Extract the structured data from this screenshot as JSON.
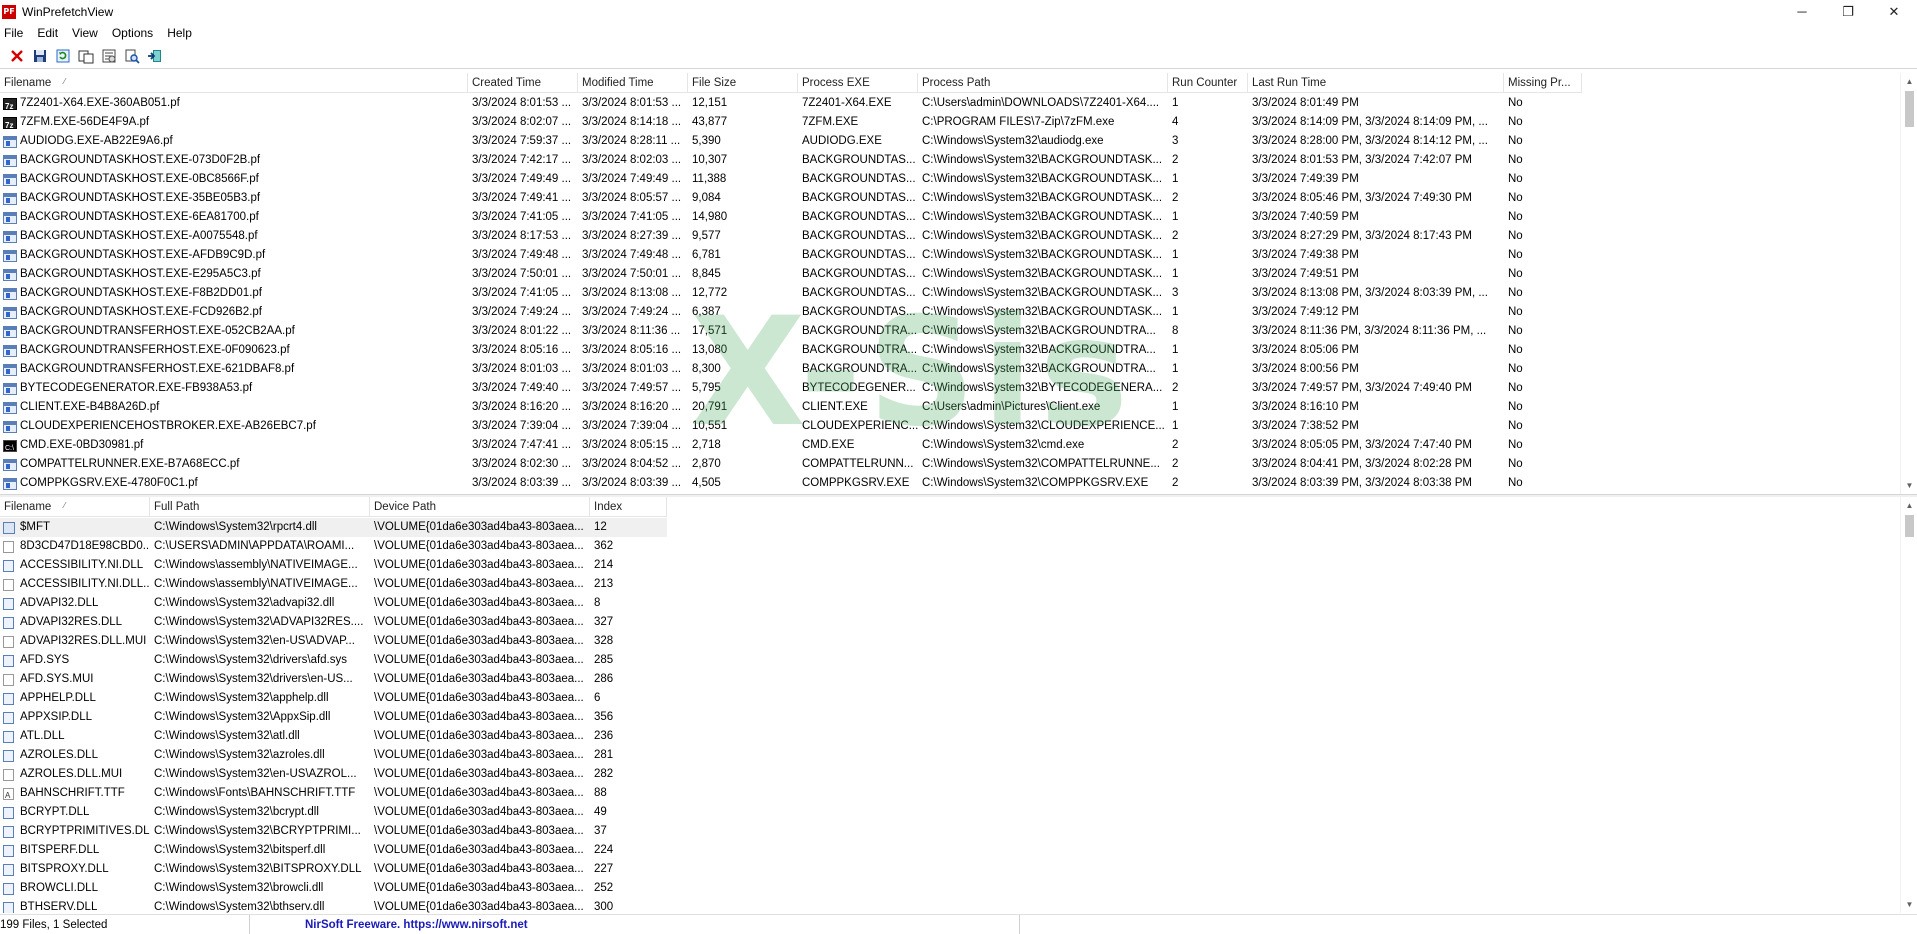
{
  "window": {
    "title": "WinPrefetchView",
    "icon_label": "PF",
    "minimize": "─",
    "restore": "❐",
    "close": "✕"
  },
  "menu": [
    "File",
    "Edit",
    "View",
    "Options",
    "Help"
  ],
  "toolbar": [
    "delete-icon",
    "save-icon",
    "refresh-icon",
    "copy-icon",
    "properties-icon",
    "find-icon",
    "exit-icon"
  ],
  "top_table": {
    "columns": [
      "Filename",
      "Created Time",
      "Modified Time",
      "File Size",
      "Process EXE",
      "Process Path",
      "Run Counter",
      "Last Run Time",
      "Missing Pr..."
    ],
    "sort_indicator": "⁄",
    "rows": [
      [
        "zip",
        "7Z2401-X64.EXE-360AB051.pf",
        "3/3/2024 8:01:53 ...",
        "3/3/2024 8:01:53 ...",
        "12,151",
        "7Z2401-X64.EXE",
        "C:\\Users\\admin\\DOWNLOADS\\7Z2401-X64....",
        "1",
        "3/3/2024 8:01:49 PM",
        "No"
      ],
      [
        "zip",
        "7ZFM.EXE-56DE4F9A.pf",
        "3/3/2024 8:02:07 ...",
        "3/3/2024 8:14:18 ...",
        "43,877",
        "7ZFM.EXE",
        "C:\\PROGRAM FILES\\7-Zip\\7zFM.exe",
        "4",
        "3/3/2024 8:14:09 PM, 3/3/2024 8:14:09 PM, ...",
        "No"
      ],
      [
        "app",
        "AUDIODG.EXE-AB22E9A6.pf",
        "3/3/2024 7:59:37 ...",
        "3/3/2024 8:28:11 ...",
        "5,390",
        "AUDIODG.EXE",
        "C:\\Windows\\System32\\audiodg.exe",
        "3",
        "3/3/2024 8:28:00 PM, 3/3/2024 8:14:12 PM, ...",
        "No"
      ],
      [
        "app",
        "BACKGROUNDTASKHOST.EXE-073D0F2B.pf",
        "3/3/2024 7:42:17 ...",
        "3/3/2024 8:02:03 ...",
        "10,307",
        "BACKGROUNDTAS...",
        "C:\\Windows\\System32\\BACKGROUNDTASK...",
        "2",
        "3/3/2024 8:01:53 PM, 3/3/2024 7:42:07 PM",
        "No"
      ],
      [
        "app",
        "BACKGROUNDTASKHOST.EXE-0BC8566F.pf",
        "3/3/2024 7:49:49 ...",
        "3/3/2024 7:49:49 ...",
        "11,388",
        "BACKGROUNDTAS...",
        "C:\\Windows\\System32\\BACKGROUNDTASK...",
        "1",
        "3/3/2024 7:49:39 PM",
        "No"
      ],
      [
        "app",
        "BACKGROUNDTASKHOST.EXE-35BE05B3.pf",
        "3/3/2024 7:49:41 ...",
        "3/3/2024 8:05:57 ...",
        "9,084",
        "BACKGROUNDTAS...",
        "C:\\Windows\\System32\\BACKGROUNDTASK...",
        "2",
        "3/3/2024 8:05:46 PM, 3/3/2024 7:49:30 PM",
        "No"
      ],
      [
        "app",
        "BACKGROUNDTASKHOST.EXE-6EA81700.pf",
        "3/3/2024 7:41:05 ...",
        "3/3/2024 7:41:05 ...",
        "14,980",
        "BACKGROUNDTAS...",
        "C:\\Windows\\System32\\BACKGROUNDTASK...",
        "1",
        "3/3/2024 7:40:59 PM",
        "No"
      ],
      [
        "app",
        "BACKGROUNDTASKHOST.EXE-A0075548.pf",
        "3/3/2024 8:17:53 ...",
        "3/3/2024 8:27:39 ...",
        "9,577",
        "BACKGROUNDTAS...",
        "C:\\Windows\\System32\\BACKGROUNDTASK...",
        "2",
        "3/3/2024 8:27:29 PM, 3/3/2024 8:17:43 PM",
        "No"
      ],
      [
        "app",
        "BACKGROUNDTASKHOST.EXE-AFDB9C9D.pf",
        "3/3/2024 7:49:48 ...",
        "3/3/2024 7:49:48 ...",
        "6,781",
        "BACKGROUNDTAS...",
        "C:\\Windows\\System32\\BACKGROUNDTASK...",
        "1",
        "3/3/2024 7:49:38 PM",
        "No"
      ],
      [
        "app",
        "BACKGROUNDTASKHOST.EXE-E295A5C3.pf",
        "3/3/2024 7:50:01 ...",
        "3/3/2024 7:50:01 ...",
        "8,845",
        "BACKGROUNDTAS...",
        "C:\\Windows\\System32\\BACKGROUNDTASK...",
        "1",
        "3/3/2024 7:49:51 PM",
        "No"
      ],
      [
        "app",
        "BACKGROUNDTASKHOST.EXE-F8B2DD01.pf",
        "3/3/2024 7:41:05 ...",
        "3/3/2024 8:13:08 ...",
        "12,772",
        "BACKGROUNDTAS...",
        "C:\\Windows\\System32\\BACKGROUNDTASK...",
        "3",
        "3/3/2024 8:13:08 PM, 3/3/2024 8:03:39 PM, ...",
        "No"
      ],
      [
        "app",
        "BACKGROUNDTASKHOST.EXE-FCD926B2.pf",
        "3/3/2024 7:49:24 ...",
        "3/3/2024 7:49:24 ...",
        "6,387",
        "BACKGROUNDTAS...",
        "C:\\Windows\\System32\\BACKGROUNDTASK...",
        "1",
        "3/3/2024 7:49:12 PM",
        "No"
      ],
      [
        "app",
        "BACKGROUNDTRANSFERHOST.EXE-052CB2AA.pf",
        "3/3/2024 8:01:22 ...",
        "3/3/2024 8:11:36 ...",
        "17,571",
        "BACKGROUNDTRA...",
        "C:\\Windows\\System32\\BACKGROUNDTRA...",
        "8",
        "3/3/2024 8:11:36 PM, 3/3/2024 8:11:36 PM, ...",
        "No"
      ],
      [
        "app",
        "BACKGROUNDTRANSFERHOST.EXE-0F090623.pf",
        "3/3/2024 8:05:16 ...",
        "3/3/2024 8:05:16 ...",
        "13,080",
        "BACKGROUNDTRA...",
        "C:\\Windows\\System32\\BACKGROUNDTRA...",
        "1",
        "3/3/2024 8:05:06 PM",
        "No"
      ],
      [
        "app",
        "BACKGROUNDTRANSFERHOST.EXE-621DBAF8.pf",
        "3/3/2024 8:01:03 ...",
        "3/3/2024 8:01:03 ...",
        "8,300",
        "BACKGROUNDTRA...",
        "C:\\Windows\\System32\\BACKGROUNDTRA...",
        "1",
        "3/3/2024 8:00:56 PM",
        "No"
      ],
      [
        "app",
        "BYTECODEGENERATOR.EXE-FB938A53.pf",
        "3/3/2024 7:49:40 ...",
        "3/3/2024 7:49:57 ...",
        "5,795",
        "BYTECODEGENER...",
        "C:\\Windows\\System32\\BYTECODEGENERA...",
        "2",
        "3/3/2024 7:49:57 PM, 3/3/2024 7:49:40 PM",
        "No"
      ],
      [
        "app",
        "CLIENT.EXE-B4B8A26D.pf",
        "3/3/2024 8:16:20 ...",
        "3/3/2024 8:16:20 ...",
        "20,791",
        "CLIENT.EXE",
        "C:\\Users\\admin\\Pictures\\Client.exe",
        "1",
        "3/3/2024 8:16:10 PM",
        "No"
      ],
      [
        "app",
        "CLOUDEXPERIENCEHOSTBROKER.EXE-AB26EBC7.pf",
        "3/3/2024 7:39:04 ...",
        "3/3/2024 7:39:04 ...",
        "10,551",
        "CLOUDEXPERIENC...",
        "C:\\Windows\\System32\\CLOUDEXPERIENCE...",
        "1",
        "3/3/2024 7:38:52 PM",
        "No"
      ],
      [
        "cmd",
        "CMD.EXE-0BD30981.pf",
        "3/3/2024 7:47:41 ...",
        "3/3/2024 8:05:15 ...",
        "2,718",
        "CMD.EXE",
        "C:\\Windows\\System32\\cmd.exe",
        "2",
        "3/3/2024 8:05:05 PM, 3/3/2024 7:47:40 PM",
        "No"
      ],
      [
        "app",
        "COMPATTELRUNNER.EXE-B7A68ECC.pf",
        "3/3/2024 8:02:30 ...",
        "3/3/2024 8:04:52 ...",
        "2,870",
        "COMPATTELRUNN...",
        "C:\\Windows\\System32\\COMPATTELRUNNE...",
        "2",
        "3/3/2024 8:04:41 PM, 3/3/2024 8:02:28 PM",
        "No"
      ],
      [
        "app",
        "COMPPKGSRV.EXE-4780F0C1.pf",
        "3/3/2024 8:03:39 ...",
        "3/3/2024 8:03:39 ...",
        "4,505",
        "COMPPKGSRV.EXE",
        "C:\\Windows\\System32\\COMPPKGSRV.EXE",
        "2",
        "3/3/2024 8:03:39 PM, 3/3/2024 8:03:38 PM",
        "No"
      ]
    ]
  },
  "bottom_table": {
    "columns": [
      "Filename",
      "Full Path",
      "Device Path",
      "Index"
    ],
    "sort_indicator": "⁄",
    "rows": [
      [
        "mft",
        "$MFT",
        "C:\\Windows\\System32\\rpcrt4.dll",
        "\\VOLUME{01da6e303ad4ba43-803aea...",
        "12"
      ],
      [
        "doc",
        "8D3CD47D18E98CBD0...",
        "C:\\USERS\\ADMIN\\APPDATA\\ROAMI...",
        "\\VOLUME{01da6e303ad4ba43-803aea...",
        "362"
      ],
      [
        "docsys",
        "ACCESSIBILITY.NI.DLL",
        "C:\\Windows\\assembly\\NATIVEIMAGE...",
        "\\VOLUME{01da6e303ad4ba43-803aea...",
        "214"
      ],
      [
        "doc",
        "ACCESSIBILITY.NI.DLL...",
        "C:\\Windows\\assembly\\NATIVEIMAGE...",
        "\\VOLUME{01da6e303ad4ba43-803aea...",
        "213"
      ],
      [
        "docsys",
        "ADVAPI32.DLL",
        "C:\\Windows\\System32\\advapi32.dll",
        "\\VOLUME{01da6e303ad4ba43-803aea...",
        "8"
      ],
      [
        "docsys",
        "ADVAPI32RES.DLL",
        "C:\\Windows\\System32\\ADVAPI32RES....",
        "\\VOLUME{01da6e303ad4ba43-803aea...",
        "327"
      ],
      [
        "doc",
        "ADVAPI32RES.DLL.MUI",
        "C:\\Windows\\System32\\en-US\\ADVAP...",
        "\\VOLUME{01da6e303ad4ba43-803aea...",
        "328"
      ],
      [
        "docsys",
        "AFD.SYS",
        "C:\\Windows\\System32\\drivers\\afd.sys",
        "\\VOLUME{01da6e303ad4ba43-803aea...",
        "285"
      ],
      [
        "doc",
        "AFD.SYS.MUI",
        "C:\\Windows\\System32\\drivers\\en-US...",
        "\\VOLUME{01da6e303ad4ba43-803aea...",
        "286"
      ],
      [
        "docsys",
        "APPHELP.DLL",
        "C:\\Windows\\System32\\apphelp.dll",
        "\\VOLUME{01da6e303ad4ba43-803aea...",
        "6"
      ],
      [
        "docsys",
        "APPXSIP.DLL",
        "C:\\Windows\\System32\\AppxSip.dll",
        "\\VOLUME{01da6e303ad4ba43-803aea...",
        "356"
      ],
      [
        "docsys",
        "ATL.DLL",
        "C:\\Windows\\System32\\atl.dll",
        "\\VOLUME{01da6e303ad4ba43-803aea...",
        "236"
      ],
      [
        "docsys",
        "AZROLES.DLL",
        "C:\\Windows\\System32\\azroles.dll",
        "\\VOLUME{01da6e303ad4ba43-803aea...",
        "281"
      ],
      [
        "doc",
        "AZROLES.DLL.MUI",
        "C:\\Windows\\System32\\en-US\\AZROL...",
        "\\VOLUME{01da6e303ad4ba43-803aea...",
        "282"
      ],
      [
        "font",
        "BAHNSCHRIFT.TTF",
        "C:\\Windows\\Fonts\\BAHNSCHRIFT.TTF",
        "\\VOLUME{01da6e303ad4ba43-803aea...",
        "88"
      ],
      [
        "docsys",
        "BCRYPT.DLL",
        "C:\\Windows\\System32\\bcrypt.dll",
        "\\VOLUME{01da6e303ad4ba43-803aea...",
        "49"
      ],
      [
        "docsys",
        "BCRYPTPRIMITIVES.DLL",
        "C:\\Windows\\System32\\BCRYPTPRIMI...",
        "\\VOLUME{01da6e303ad4ba43-803aea...",
        "37"
      ],
      [
        "docsys",
        "BITSPERF.DLL",
        "C:\\Windows\\System32\\bitsperf.dll",
        "\\VOLUME{01da6e303ad4ba43-803aea...",
        "224"
      ],
      [
        "docsys",
        "BITSPROXY.DLL",
        "C:\\Windows\\System32\\BITSPROXY.DLL",
        "\\VOLUME{01da6e303ad4ba43-803aea...",
        "227"
      ],
      [
        "docsys",
        "BROWCLI.DLL",
        "C:\\Windows\\System32\\browcli.dll",
        "\\VOLUME{01da6e303ad4ba43-803aea...",
        "252"
      ],
      [
        "docsys",
        "BTHSERV.DLL",
        "C:\\Windows\\System32\\bthserv.dll",
        "\\VOLUME{01da6e303ad4ba43-803aea...",
        "300"
      ]
    ]
  },
  "watermark": "X-Sis",
  "status": {
    "count": "199 Files, 1 Selected",
    "link": "NirSoft Freeware. https://www.nirsoft.net"
  }
}
